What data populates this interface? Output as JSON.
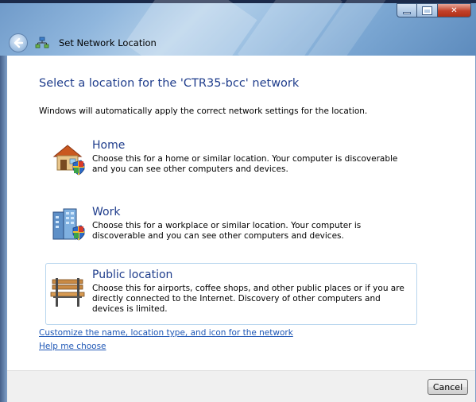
{
  "window": {
    "title": "Set Network Location"
  },
  "main": {
    "heading": "Select a location for the 'CTR35-bcc' network",
    "subtext": "Windows will automatically apply the correct network settings for the location."
  },
  "options": [
    {
      "title": "Home",
      "description": "Choose this for a home or similar location. Your computer is discoverable and you can see other computers and devices.",
      "icon": "home-icon"
    },
    {
      "title": "Work",
      "description": "Choose this for a workplace or similar location. Your computer is discoverable and you can see other computers and devices.",
      "icon": "work-icon"
    },
    {
      "title": "Public location",
      "description": "Choose this for airports, coffee shops, and other public places or if you are directly connected to the Internet. Discovery of other computers and devices is limited.",
      "icon": "bench-icon"
    }
  ],
  "links": {
    "customize": "Customize the name, location type, and icon for the network",
    "help": "Help me choose"
  },
  "footer": {
    "cancel_label": "Cancel"
  },
  "colors": {
    "heading": "#1f3d8c",
    "link": "#1d56b5",
    "selection_border": "#b8d6ee"
  }
}
